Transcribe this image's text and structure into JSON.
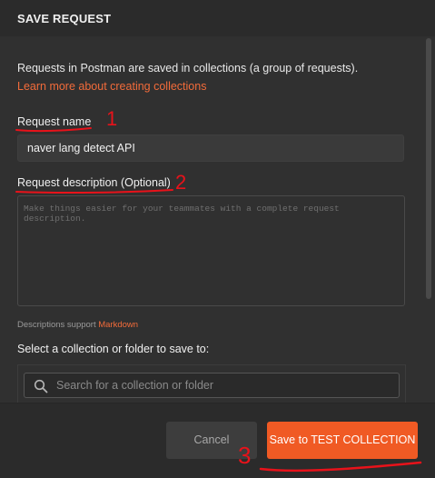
{
  "dialog": {
    "title": "SAVE REQUEST",
    "intro_text": "Requests in Postman are saved in collections (a group of requests).",
    "learn_more_link": "Learn more about creating collections",
    "request_name_label": "Request name",
    "request_name_value": "naver lang detect API",
    "request_description_label": "Request description (Optional)",
    "request_description_placeholder": "Make things easier for your teammates with a complete request description.",
    "descriptions_hint": "Descriptions support",
    "markdown_link": "Markdown",
    "select_label": "Select a collection or folder to save to:",
    "search_placeholder": "Search for a collection or folder",
    "cancel_label": "Cancel",
    "save_label": "Save to TEST COLLECTION"
  },
  "annotations": {
    "mark_1": "1",
    "mark_2": "2",
    "mark_3": "3"
  },
  "colors": {
    "accent": "#f05a24",
    "annotation": "#e8121a",
    "background": "#303030"
  }
}
